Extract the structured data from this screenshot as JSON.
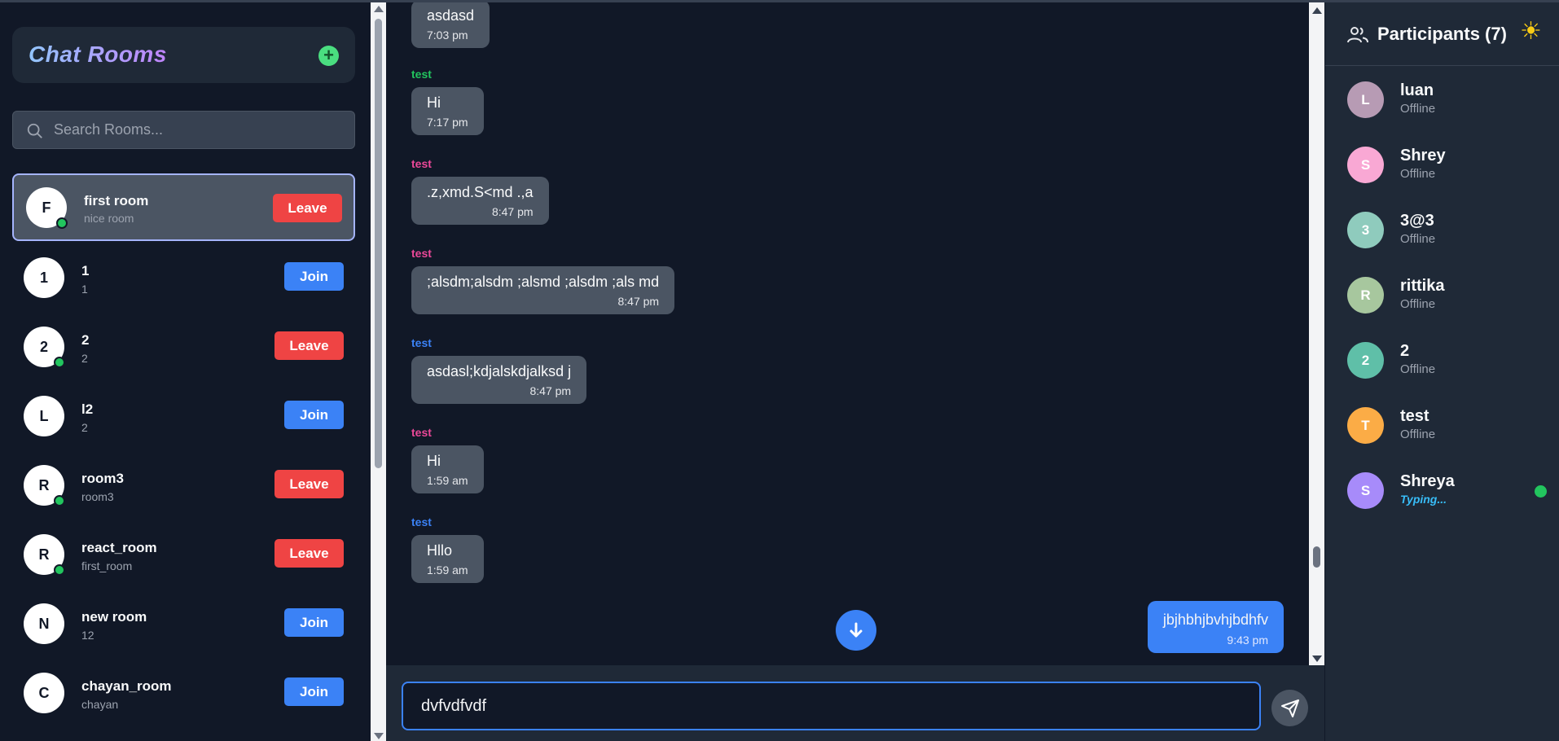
{
  "sidebar": {
    "title": "Chat Rooms",
    "add_icon": "plus-circle-icon",
    "search": {
      "placeholder": "Search Rooms..."
    },
    "rooms": [
      {
        "initial": "F",
        "name": "first room",
        "desc": "nice room",
        "action": "Leave",
        "online": true,
        "active": true
      },
      {
        "initial": "1",
        "name": "1",
        "desc": "1",
        "action": "Join",
        "online": false,
        "active": false
      },
      {
        "initial": "2",
        "name": "2",
        "desc": "2",
        "action": "Leave",
        "online": true,
        "active": false
      },
      {
        "initial": "L",
        "name": "l2",
        "desc": "2",
        "action": "Join",
        "online": false,
        "active": false
      },
      {
        "initial": "R",
        "name": "room3",
        "desc": "room3",
        "action": "Leave",
        "online": true,
        "active": false
      },
      {
        "initial": "R",
        "name": "react_room",
        "desc": "first_room",
        "action": "Leave",
        "online": true,
        "active": false
      },
      {
        "initial": "N",
        "name": "new room",
        "desc": "12",
        "action": "Join",
        "online": false,
        "active": false
      },
      {
        "initial": "C",
        "name": "chayan_room",
        "desc": "chayan",
        "action": "Join",
        "online": false,
        "active": false
      }
    ]
  },
  "chat": {
    "messages": [
      {
        "sender": "",
        "sender_color": "",
        "text": "asdasd",
        "time": "7:03 pm"
      },
      {
        "sender": "test",
        "sender_color": "#22c55e",
        "text": "Hi",
        "time": "7:17 pm"
      },
      {
        "sender": "test",
        "sender_color": "#ec4899",
        "text": ".z,xmd.S<md .,a",
        "time": "8:47 pm"
      },
      {
        "sender": "test",
        "sender_color": "#ec4899",
        "text": ";alsdm;alsdm ;alsmd ;alsdm ;als md",
        "time": "8:47 pm"
      },
      {
        "sender": "test",
        "sender_color": "#3b82f6",
        "text": "asdasl;kdjalskdjalksd j",
        "time": "8:47 pm"
      },
      {
        "sender": "test",
        "sender_color": "#ec4899",
        "text": "Hi",
        "time": "1:59 am"
      },
      {
        "sender": "test",
        "sender_color": "#3b82f6",
        "text": "Hllo",
        "time": "1:59 am"
      }
    ],
    "own_message": {
      "text": "jbjhbhjbvhjbdhfv",
      "time": "9:43 pm"
    },
    "scroll_down_icon": "arrow-down-icon",
    "composer": {
      "value": "dvfvdfvdf",
      "send_icon": "send-icon"
    }
  },
  "participants": {
    "title": "Participants (7)",
    "header_icon": "users-icon",
    "theme_icon": "sun-icon",
    "list": [
      {
        "initial": "L",
        "name": "luan",
        "status": "Offline",
        "color": "#b79bb4",
        "typing": false,
        "online": false
      },
      {
        "initial": "S",
        "name": "Shrey",
        "status": "Offline",
        "color": "#f9a8d4",
        "typing": false,
        "online": false
      },
      {
        "initial": "3",
        "name": "3@3",
        "status": "Offline",
        "color": "#8fcbbd",
        "typing": false,
        "online": false
      },
      {
        "initial": "R",
        "name": "rittika",
        "status": "Offline",
        "color": "#a7c79e",
        "typing": false,
        "online": false
      },
      {
        "initial": "2",
        "name": "2",
        "status": "Offline",
        "color": "#5fbfa8",
        "typing": false,
        "online": false
      },
      {
        "initial": "T",
        "name": "test",
        "status": "Offline",
        "color": "#fbac46",
        "typing": false,
        "online": false
      },
      {
        "initial": "S",
        "name": "Shreya",
        "status": "Typing...",
        "color": "#a78bfa",
        "typing": true,
        "online": true
      }
    ]
  }
}
